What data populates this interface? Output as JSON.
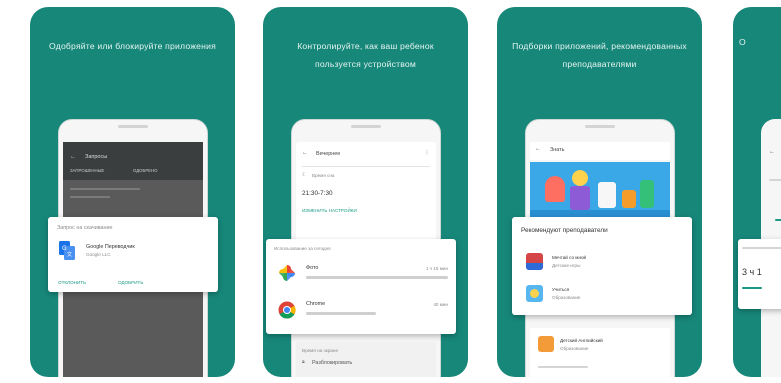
{
  "screens": [
    {
      "caption": "Одобряйте или блокируйте приложения",
      "phone": {
        "toolbar_title": "Запросы",
        "tabs": [
          "ЗАПРОШЕННЫЕ",
          "ОДОБРЕНО"
        ],
        "dialog": {
          "title": "Запрос на скачивание",
          "app_name": "Google Переводчик",
          "developer": "Google LLC",
          "deny_label": "ОТКЛОНИТЬ",
          "approve_label": "ОДОБРИТЬ"
        }
      }
    },
    {
      "caption": "Контролируйте, как ваш ребенок пользуется устройством",
      "phone": {
        "toolbar_title": "Вечернее",
        "section_label": "Время сна",
        "time_range": "21:30-7:30",
        "settings_link": "ИЗМЕНИТЬ НАСТРОЙКИ",
        "usage_header": "Использование за сегодня",
        "apps": [
          {
            "name": "Фото",
            "time": "1 ч 15 мин"
          },
          {
            "name": "Chrome",
            "time": "40 мин"
          }
        ],
        "footer_label": "Время на экране",
        "footer_item": "Разблокировать"
      }
    },
    {
      "caption": "Подборки приложений, рекомендованных преподавателями",
      "phone": {
        "toolbar_title": "Знать",
        "panel_title": "Рекомендуют преподаватели",
        "apps": [
          {
            "name": "Мечтай со мной",
            "subtitle": "Детские игры"
          },
          {
            "name": "Учиться",
            "subtitle": "Образование"
          },
          {
            "name": "Детский Английский",
            "subtitle": "Образование"
          }
        ]
      }
    },
    {
      "caption": "О",
      "phone": {
        "time_text": "3 ч 1"
      }
    }
  ],
  "colors": {
    "card_bg": "#17877a",
    "caption_text": "#e6f4f1",
    "accent_green": "#1a9a86",
    "dark_toolbar": "#3b3e3f",
    "translate_blue": "#1a73e8",
    "chrome_red": "#db4437",
    "chrome_yellow": "#f4b400",
    "chrome_green": "#0f9d58",
    "banner_blue": "#3aa7e6"
  },
  "icons": {
    "menu": "menu-icon",
    "more": "more-vert-icon",
    "back": "arrow-back-icon",
    "translate": "google-translate-icon",
    "photos": "google-photos-icon",
    "chrome": "chrome-icon",
    "game": "app-game-icon",
    "education": "app-education-icon",
    "english": "app-english-icon"
  }
}
